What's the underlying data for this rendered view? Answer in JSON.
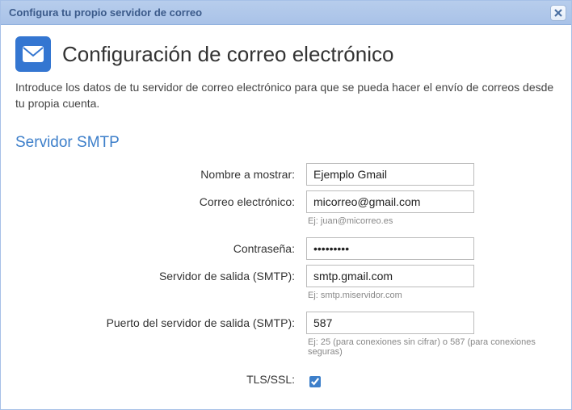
{
  "window": {
    "title": "Configura tu propio servidor de correo"
  },
  "header": {
    "title": "Configuración de correo electrónico",
    "intro": "Introduce los datos de tu servidor de correo electrónico para que se pueda hacer el envío de correos desde tu propia cuenta."
  },
  "section": {
    "heading": "Servidor SMTP"
  },
  "fields": {
    "display_name": {
      "label": "Nombre a mostrar:",
      "value": "Ejemplo Gmail"
    },
    "email": {
      "label": "Correo electrónico:",
      "value": "micorreo@gmail.com",
      "hint": "Ej: juan@micorreo.es"
    },
    "password": {
      "label": "Contraseña:",
      "value": "•••••••••"
    },
    "smtp_server": {
      "label": "Servidor de salida (SMTP):",
      "value": "smtp.gmail.com",
      "hint": "Ej: smtp.miservidor.com"
    },
    "smtp_port": {
      "label": "Puerto del servidor de salida (SMTP):",
      "value": "587",
      "hint": "Ej: 25 (para conexiones sin cifrar) o 587 (para conexiones seguras)"
    },
    "tls": {
      "label": "TLS/SSL:",
      "checked": true
    }
  }
}
